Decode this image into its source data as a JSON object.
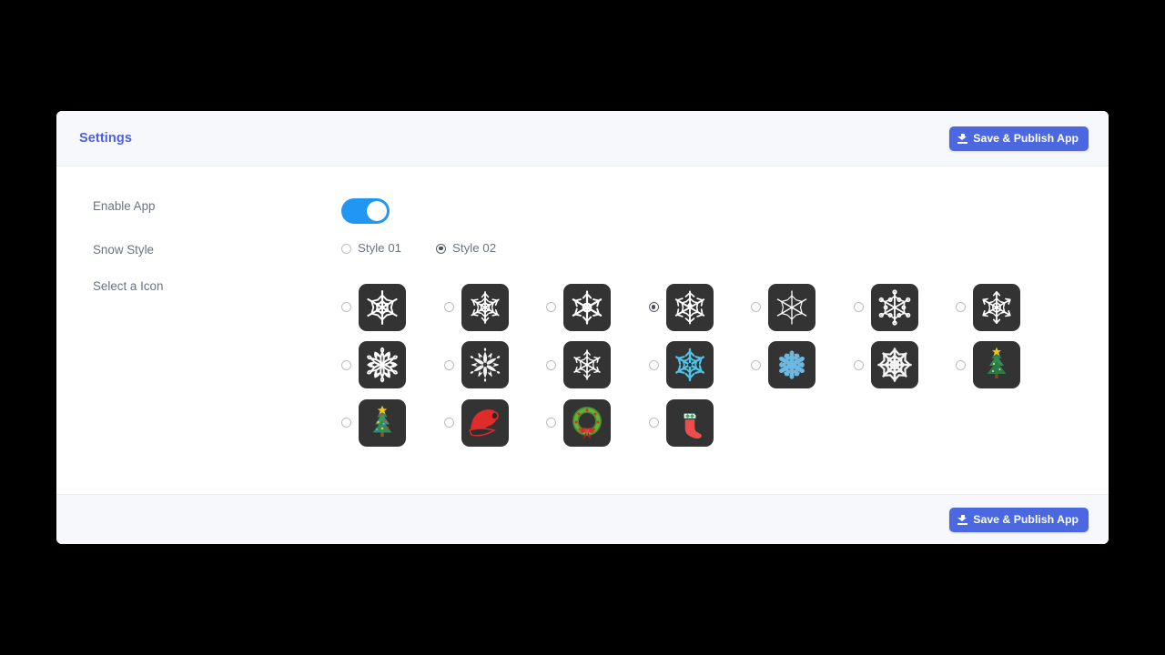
{
  "window": {
    "background_color": "#000000",
    "card_background": "#ffffff"
  },
  "header": {
    "title": "Settings",
    "title_color": "#4c5fe3",
    "background_color": "#f7f8fc",
    "save_button": {
      "label": "Save & Publish App",
      "icon": "download-icon",
      "color": "#4b68e0",
      "text_color": "#ffffff"
    }
  },
  "footer": {
    "background_color": "#f7f8fc",
    "save_button": {
      "label": "Save & Publish App",
      "icon": "download-icon",
      "color": "#4b68e0",
      "text_color": "#ffffff"
    }
  },
  "fields": {
    "enable_app": {
      "label": "Enable App",
      "toggle_on": true,
      "toggle_color": "#2196f3"
    },
    "snow_style": {
      "label": "Snow Style",
      "selected": "Style 02",
      "options": [
        {
          "label": "Style 01",
          "checked": false
        },
        {
          "label": "Style 02",
          "checked": true
        }
      ]
    },
    "select_icon": {
      "label": "Select a Icon",
      "selected_index": 3,
      "tile_background": "#333333",
      "columns": 7,
      "icons": [
        {
          "id": "snowflake-classic-01",
          "name": "snowflake-classic-icon",
          "checked": false,
          "color": "#ffffff"
        },
        {
          "id": "snowflake-classic-02",
          "name": "snowflake-feathered-icon",
          "checked": false,
          "color": "#ffffff"
        },
        {
          "id": "snowflake-ring-03",
          "name": "snowflake-ring-icon",
          "checked": false,
          "color": "#ffffff"
        },
        {
          "id": "snowflake-star-04",
          "name": "snowflake-star-icon",
          "checked": true,
          "color": "#ffffff"
        },
        {
          "id": "snowflake-thin-05",
          "name": "snowflake-thin-icon",
          "checked": false,
          "color": "#ffffff"
        },
        {
          "id": "snowflake-dotted-06",
          "name": "snowflake-dotted-icon",
          "checked": false,
          "color": "#ffffff"
        },
        {
          "id": "snowflake-arrow-07",
          "name": "snowflake-arrow-icon",
          "checked": false,
          "color": "#ffffff"
        },
        {
          "id": "snowflake-petal-08",
          "name": "snowflake-petal-icon",
          "checked": false,
          "color": "#ffffff"
        },
        {
          "id": "snowflake-ornate-09",
          "name": "snowflake-ornate-icon",
          "checked": false,
          "color": "#ffffff"
        },
        {
          "id": "snowflake-crystal-10",
          "name": "snowflake-crystal-icon",
          "checked": false,
          "color": "#ffffff"
        },
        {
          "id": "snowflake-blue-11",
          "name": "snowflake-blue-icon",
          "checked": false,
          "color": "#4fc3e8"
        },
        {
          "id": "snowflake-blue-solid-12",
          "name": "snowflake-blue-solid-icon",
          "checked": false,
          "color": "#6cb8e0"
        },
        {
          "id": "snowflake-white-13",
          "name": "snowflake-white-full-icon",
          "checked": false,
          "color": "#f2f2f2"
        },
        {
          "id": "christmas-tree-14",
          "name": "christmas-tree-icon",
          "checked": false,
          "color": "#2e8b4f"
        },
        {
          "id": "christmas-tree-15",
          "name": "christmas-tree-decorated-icon",
          "checked": false,
          "color": "#2e8b57"
        },
        {
          "id": "santa-hat-16",
          "name": "santa-hat-icon",
          "checked": false,
          "color": "#e02b2b"
        },
        {
          "id": "wreath-17",
          "name": "wreath-icon",
          "checked": false,
          "color": "#5aa02c"
        },
        {
          "id": "stocking-18",
          "name": "christmas-stocking-icon",
          "checked": false,
          "color": "#ef4b4b"
        }
      ]
    }
  }
}
